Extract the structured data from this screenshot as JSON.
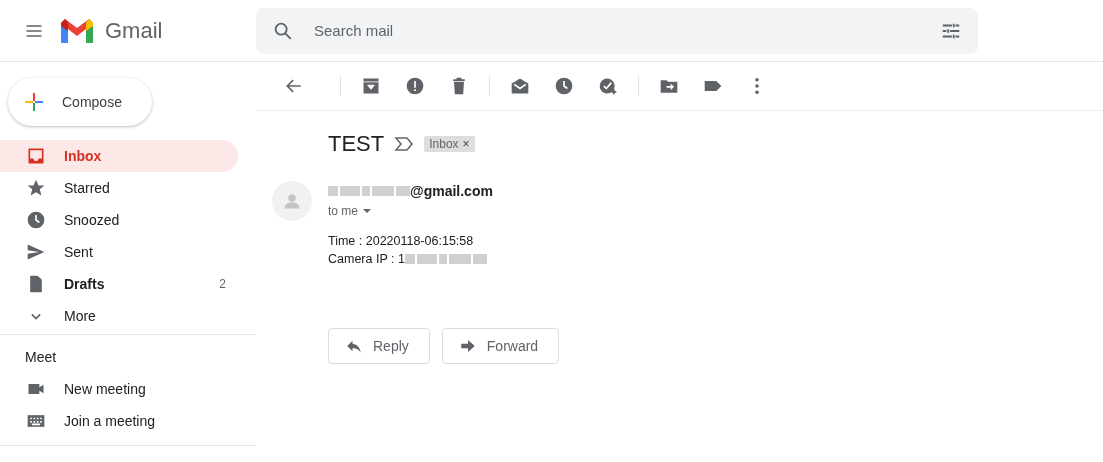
{
  "header": {
    "app_name": "Gmail",
    "search": {
      "placeholder": "Search mail"
    }
  },
  "compose": {
    "label": "Compose"
  },
  "nav": [
    {
      "kind": "inbox",
      "label": "Inbox",
      "selected": true,
      "unread": true
    },
    {
      "kind": "star",
      "label": "Starred",
      "selected": false,
      "unread": false
    },
    {
      "kind": "clock",
      "label": "Snoozed",
      "selected": false,
      "unread": false
    },
    {
      "kind": "send",
      "label": "Sent",
      "selected": false,
      "unread": false
    },
    {
      "kind": "draft",
      "label": "Drafts",
      "selected": false,
      "unread": true,
      "count": "2"
    },
    {
      "kind": "chevron",
      "label": "More",
      "selected": false,
      "unread": false
    }
  ],
  "meet": {
    "title": "Meet",
    "items": [
      {
        "kind": "video",
        "label": "New meeting"
      },
      {
        "kind": "keyboard",
        "label": "Join a meeting"
      }
    ]
  },
  "toolbar": [
    {
      "kind": "back"
    },
    {
      "kind": "sep"
    },
    {
      "kind": "archive"
    },
    {
      "kind": "spam"
    },
    {
      "kind": "trash"
    },
    {
      "kind": "sep"
    },
    {
      "kind": "mail"
    },
    {
      "kind": "clock"
    },
    {
      "kind": "task"
    },
    {
      "kind": "sep"
    },
    {
      "kind": "move"
    },
    {
      "kind": "label"
    },
    {
      "kind": "more"
    }
  ],
  "message": {
    "subject": "TEST",
    "label_chip": {
      "text": "Inbox",
      "remove": "×"
    },
    "sender": {
      "address_visible": "@gmail.com"
    },
    "recipient": "to me",
    "body": [
      {
        "text": "Time : 20220118-06:15:58",
        "redacted": false
      },
      {
        "text": "Camera IP : 1",
        "redacted": true
      }
    ],
    "actions": [
      {
        "kind": "reply",
        "label": "Reply"
      },
      {
        "kind": "forward",
        "label": "Forward"
      }
    ]
  }
}
